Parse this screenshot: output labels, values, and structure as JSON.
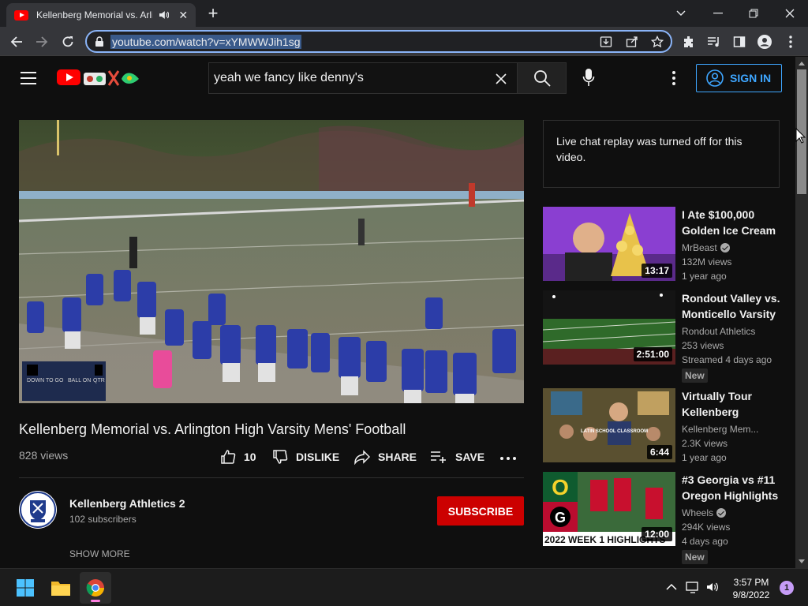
{
  "browser": {
    "tab": {
      "title": "Kellenberg Memorial vs. Arlin",
      "favicon": "youtube-favicon-icon",
      "audio_icon": "speaker-icon",
      "close_icon": "close-icon"
    },
    "new_tab_icon": "plus-icon",
    "window_controls": [
      "chevron-down-icon",
      "minimize-icon",
      "restore-icon",
      "close-icon"
    ],
    "url": "youtube.com/watch?v=xYMWWJih1sg",
    "toolbar_icons": [
      "install-icon",
      "share-icon",
      "star-icon",
      "extensions-icon",
      "media-control-icon",
      "side-panel-icon",
      "profile-icon",
      "menu-icon"
    ]
  },
  "youtube": {
    "search": {
      "value": "yeah we fancy like denny's"
    },
    "sign_in": "SIGN IN",
    "video": {
      "title": "Kellenberg Memorial vs. Arlington High Varsity Mens' Football",
      "views": "828 views",
      "likes": "10",
      "dislike": "DISLIKE",
      "share": "SHARE",
      "save": "SAVE",
      "scoreboard": {
        "labels": [
          "DOWN",
          "TO GO",
          "BALL ON",
          "QTR"
        ]
      }
    },
    "channel": {
      "name": "Kellenberg Athletics 2",
      "subscribers": "102 subscribers",
      "subscribe": "SUBSCRIBE",
      "show_more": "SHOW MORE"
    },
    "chat_notice": "Live chat replay was turned off for this video.",
    "recommendations": [
      {
        "title": "I Ate $100,000 Golden Ice Cream",
        "channel": "MrBeast",
        "verified": true,
        "views": "132M views",
        "age": "1 year ago",
        "duration": "13:17",
        "badge": ""
      },
      {
        "title": "Rondout Valley vs. Monticello Varsity Football",
        "channel": "Rondout Athletics",
        "verified": false,
        "views": "253 views",
        "age": "Streamed 4 days ago",
        "duration": "2:51:00",
        "badge": "New"
      },
      {
        "title": "Virtually Tour Kellenberg Memorial",
        "channel": "Kellenberg Mem...",
        "verified": false,
        "views": "2.3K views",
        "age": "1 year ago",
        "duration": "6:44",
        "badge": "",
        "thumb_caption": "LATIN SCHOOL CLASSROOM"
      },
      {
        "title": "#3 Georgia vs #11 Oregon Highlights",
        "channel": "Wheels",
        "verified": true,
        "views": "294K views",
        "age": "4 days ago",
        "duration": "12:00",
        "badge": "New",
        "thumb_caption": "2022 WEEK 1 HIGHLIGHTS"
      }
    ]
  },
  "taskbar": {
    "apps": [
      "windows-start-icon",
      "file-explorer-icon",
      "chrome-icon"
    ],
    "time": "3:57 PM",
    "date": "9/8/2022",
    "notification_count": "1"
  }
}
